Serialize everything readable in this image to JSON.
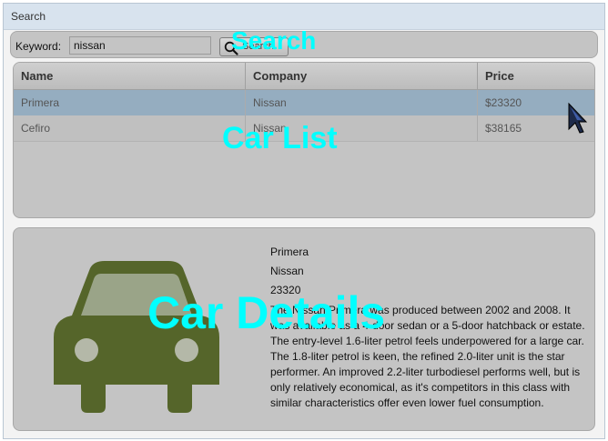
{
  "window": {
    "title": "Search"
  },
  "search": {
    "keyword_label": "Keyword:",
    "keyword_value": "nissan",
    "button_label": "Search"
  },
  "overlays": {
    "search": "Search",
    "car_list": "Car List",
    "car_details": "Car Details"
  },
  "car_list": {
    "columns": [
      "Name",
      "Company",
      "Price"
    ],
    "rows": [
      {
        "name": "Primera",
        "company": "Nissan",
        "price": "$23320",
        "selected": true
      },
      {
        "name": "Cefiro",
        "company": "Nissan",
        "price": "$38165",
        "selected": false
      }
    ]
  },
  "details": {
    "name": "Primera",
    "company": "Nissan",
    "price": "23320",
    "description": "The Nissan Primera was produced between 2002 and 2008. It was available as a 4-door sedan or a 5-door hatchback or estate. The entry-level 1.6-liter petrol feels underpowered for a large car. The 1.8-liter petrol is keen, the refined 2.0-liter unit is the star performer. An improved 2.2-liter turbodiesel performs well, but is only relatively economical, as it's competitors in this class with similar characteristics offer even lower fuel consumption.",
    "image_icon": "car-icon"
  },
  "colors": {
    "overlay_text": "#00ffff",
    "panel_bg": "#c4c4c4",
    "selected_row": "#95adc0",
    "car_icon": "#55652a",
    "title_bar": "#d8e3ee"
  }
}
